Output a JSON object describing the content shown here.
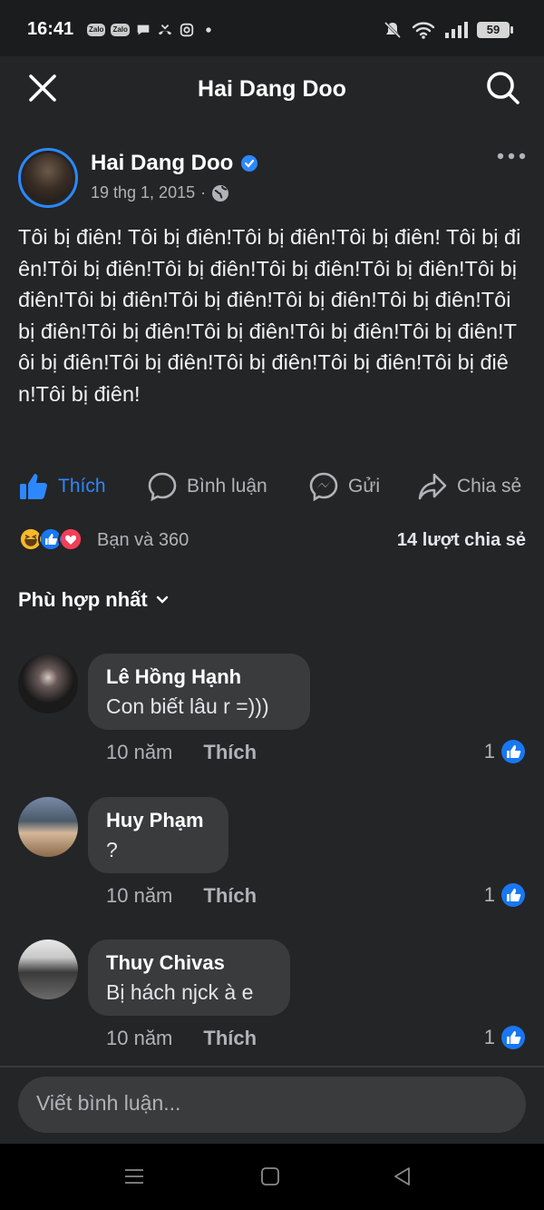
{
  "status": {
    "time": "16:41",
    "battery": "59",
    "zalo1": "Zalo",
    "zalo2": "Zalo"
  },
  "topbar": {
    "title": "Hai Dang Doo"
  },
  "post": {
    "author": "Hai Dang Doo",
    "date": "19 thg 1, 2015",
    "separator": "·",
    "text": "Tôi bị điên! Tôi bị điên!Tôi bị điên!Tôi bị điên! Tôi bị điên!Tôi bị điên!Tôi bị điên!Tôi bị điên!Tôi bị điên!Tôi bị điên!Tôi bị điên!Tôi bị điên!Tôi bị điên!Tôi bị điên!Tôi bị điên!Tôi bị điên!Tôi bị điên!Tôi bị điên!Tôi bị điên!Tôi bị điên!Tôi bị điên!Tôi bị điên!Tôi bị điên!Tôi bị điên!Tôi bị điên!"
  },
  "actions": {
    "like": "Thích",
    "comment": "Bình luận",
    "send": "Gửi",
    "share": "Chia sẻ"
  },
  "stats": {
    "reactions": "Bạn và 360",
    "shares": "14 lượt chia sẻ"
  },
  "sort": {
    "label": "Phù hợp nhất"
  },
  "comments": [
    {
      "name": "Lê Hồng Hạnh",
      "text": "Con biết lâu r =)))",
      "time": "10 năm",
      "like_label": "Thích",
      "likes": "1"
    },
    {
      "name": "Huy Phạm",
      "text": "?",
      "time": "10 năm",
      "like_label": "Thích",
      "likes": "1"
    },
    {
      "name": "Thuy Chivas",
      "text": "Bị hách njck à e",
      "time": "10 năm",
      "like_label": "Thích",
      "likes": "1"
    }
  ],
  "composer": {
    "placeholder": "Viết bình luận..."
  },
  "colors": {
    "accent": "#2d88ff",
    "background": "#242526",
    "bubble": "#3a3b3c"
  },
  "icons": [
    "close-icon",
    "search-icon",
    "verified-icon",
    "globe-icon",
    "more-icon",
    "like-icon",
    "comment-icon",
    "messenger-icon",
    "share-icon",
    "haha-reaction-icon",
    "like-reaction-icon",
    "love-reaction-icon",
    "chevron-down-icon"
  ]
}
